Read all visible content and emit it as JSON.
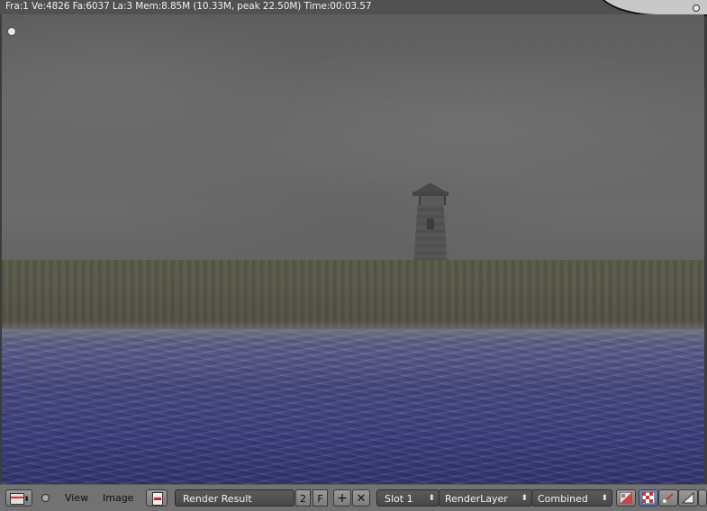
{
  "render_info": "Fra:1  Ve:4826 Fa:6037 La:3 Mem:8.85M (10.33M, peak 22.50M) Time:00:03.57",
  "toolbar": {
    "view_menu": "View",
    "image_menu": "Image",
    "image_name": "Render Result",
    "users_count": "2",
    "fake_user": "F",
    "new_image": "+",
    "unlink": "✕",
    "slot": "Slot 1",
    "render_layer": "RenderLayer",
    "render_pass": "Combined",
    "select_arrows": "⬍"
  },
  "icons": {
    "editor_type": "image-editor-icon",
    "browse": "image-browse-icon",
    "channels": "draw-channels-icon",
    "alpha": "alpha-checker-icon"
  },
  "colors": {
    "toolbar_bg": "#727272",
    "sky": "#686868",
    "water": "#3c3f7c"
  }
}
